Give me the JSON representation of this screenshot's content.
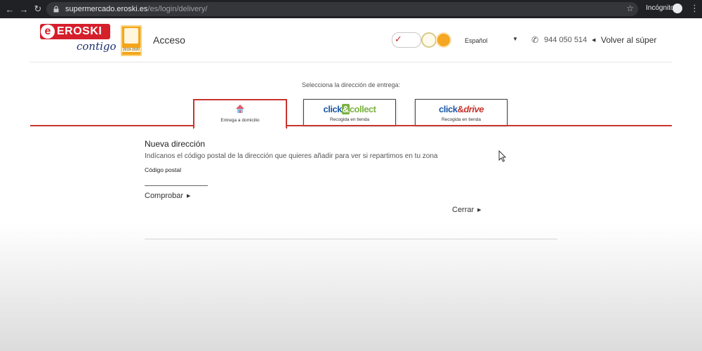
{
  "browser": {
    "url_host": "supermercado.eroski.es",
    "url_path": "/es/login/delivery/",
    "incognito_label": "Incógnito"
  },
  "header": {
    "logo_word": "EROSKI",
    "logo_tagline": "contigo",
    "award_year": "2019-2020",
    "page_title": "Acceso",
    "language": "Español",
    "phone": "944 050 514",
    "back_link": "Volver al súper"
  },
  "delivery": {
    "prompt": "Selecciona la dirección de entrega:",
    "tabs": [
      {
        "label": "Entrega a domicilio",
        "active": true
      },
      {
        "brand": [
          "click",
          "&",
          "collect"
        ],
        "label": "Recogida en tienda",
        "active": false
      },
      {
        "brand": [
          "click",
          "&",
          "drive"
        ],
        "label": "Recogida en tienda",
        "active": false
      }
    ]
  },
  "form": {
    "title": "Nueva dirección",
    "description": "Indícanos el código postal de la dirección que quieres añadir para ver si repartimos en tu zona",
    "postal_label": "Código postal",
    "postal_value": "",
    "check_button": "Comprobar",
    "close_button": "Cerrar"
  },
  "colors": {
    "brand_red": "#d51f2b",
    "tab_red": "#c8352e",
    "collect_green": "#7bb241",
    "click_blue": "#1d5aa6"
  }
}
